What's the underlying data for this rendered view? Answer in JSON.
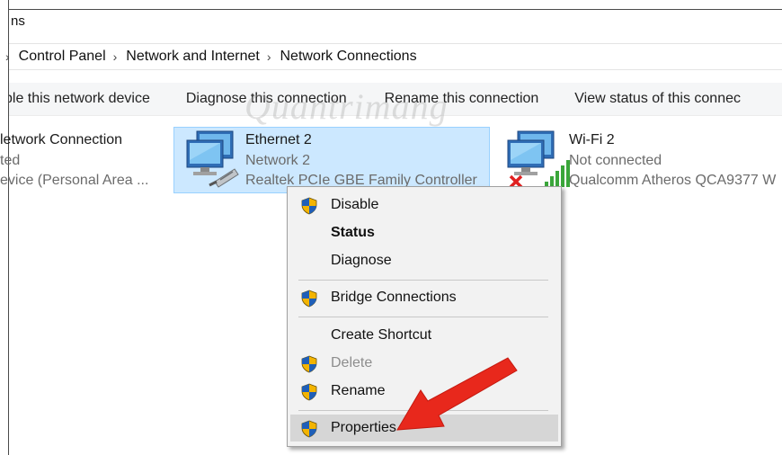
{
  "window": {
    "title_fragment": "ns"
  },
  "breadcrumb": [
    "Control Panel",
    "Network and Internet",
    "Network Connections"
  ],
  "command_bar": {
    "items": [
      "ble this network device",
      "Diagnose this connection",
      "Rename this connection",
      "View status of this connec"
    ]
  },
  "watermark": "Quantrimang",
  "connections": [
    {
      "name": "letwork Connection",
      "status": "ted",
      "device": "evice (Personal Area ..."
    },
    {
      "name": "Ethernet 2",
      "status": "Network  2",
      "device": "Realtek PCIe GBE Family Controller",
      "selected": true
    },
    {
      "name": "Wi-Fi 2",
      "status": "Not connected",
      "device": "Qualcomm Atheros QCA9377 W"
    }
  ],
  "context_menu": {
    "items": [
      {
        "label": "Disable",
        "shield": true
      },
      {
        "label": "Status",
        "bold": true
      },
      {
        "label": "Diagnose"
      },
      {
        "label": "Bridge Connections",
        "shield": true
      },
      {
        "label": "Create Shortcut"
      },
      {
        "label": "Delete",
        "shield": true,
        "disabled": true
      },
      {
        "label": "Rename",
        "shield": true
      },
      {
        "label": "Properties",
        "shield": true,
        "highlighted": true
      }
    ]
  },
  "colors": {
    "selection": "#cce8ff",
    "arrow": "#e8281c",
    "menu_bg": "#f2f2f2"
  }
}
